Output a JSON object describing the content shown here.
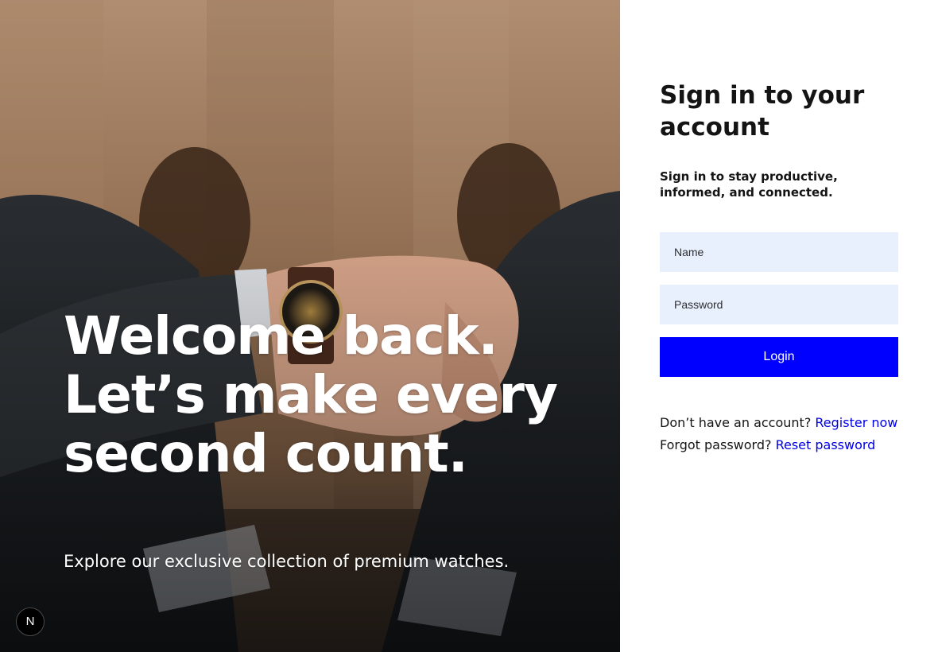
{
  "hero": {
    "headline": "Welcome back. Let’s make every second count.",
    "subline": "Explore our exclusive collection of premium watches.",
    "badge_label": "N"
  },
  "form": {
    "title": "Sign in to your account",
    "subtitle": "Sign in to stay productive, informed, and connected.",
    "name_placeholder": "Name",
    "name_value": "",
    "password_placeholder": "Password",
    "password_value": "",
    "login_label": "Login"
  },
  "links": {
    "register_prompt": "Don’t have an account?",
    "register_label": "Register now",
    "reset_prompt": "Forgot password?",
    "reset_label": "Reset password"
  },
  "colors": {
    "accent": "#0000ff",
    "input_background": "#e8effd",
    "link": "#0000e6"
  }
}
